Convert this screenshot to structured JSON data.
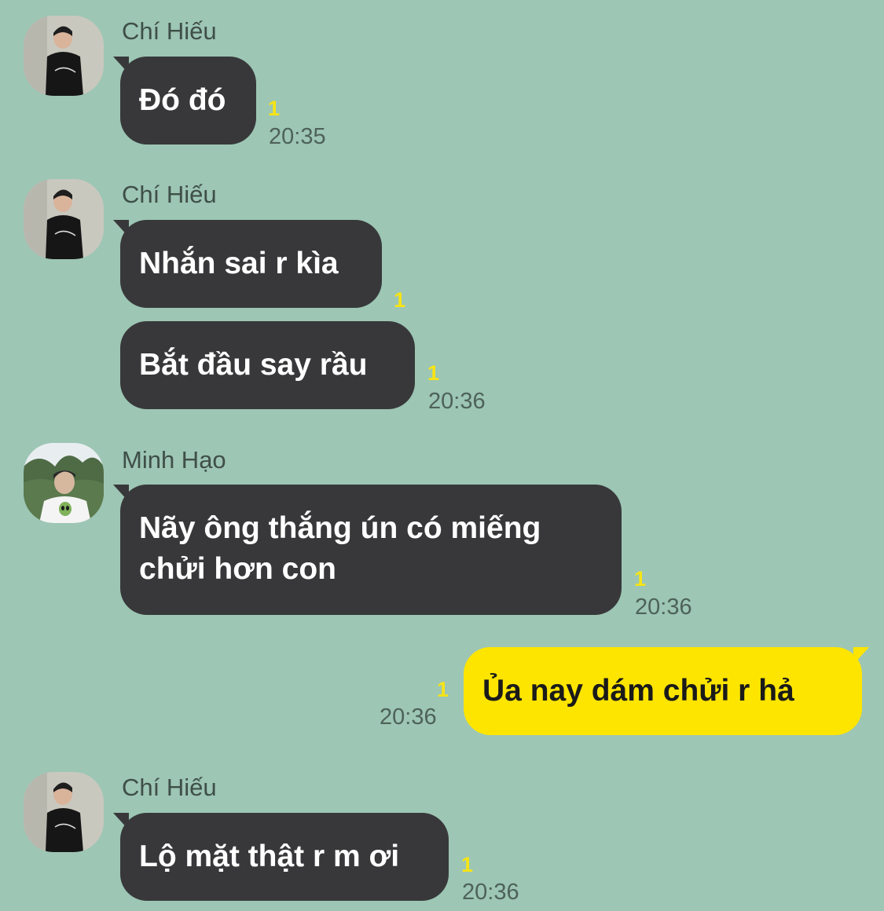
{
  "colors": {
    "background": "#9dc6b4",
    "incoming_bubble": "#38383a",
    "outgoing_bubble": "#fee500",
    "unread_count": "#f7e415"
  },
  "messages": [
    {
      "sender": "Chí Hiếu",
      "bubbles": [
        "Đó đó"
      ],
      "unread": "1",
      "time": "20:35"
    },
    {
      "sender": "Chí Hiếu",
      "bubbles": [
        "Nhắn sai r kìa",
        "Bắt đầu say rầu"
      ],
      "unread_1": "1",
      "unread_2": "1",
      "time": "20:36"
    },
    {
      "sender": "Minh Hạo",
      "line1": "Nãy ông thắng ún có miếng",
      "line2": "chửi hơn con",
      "unread": "1",
      "time": "20:36"
    },
    {
      "sender": "me",
      "text": "Ủa nay dám chửi r hả",
      "unread": "1",
      "time": "20:36"
    },
    {
      "sender": "Chí Hiếu",
      "bubbles": [
        "Lộ mặt thật r m ơi"
      ],
      "unread": "1",
      "time": "20:36"
    }
  ]
}
